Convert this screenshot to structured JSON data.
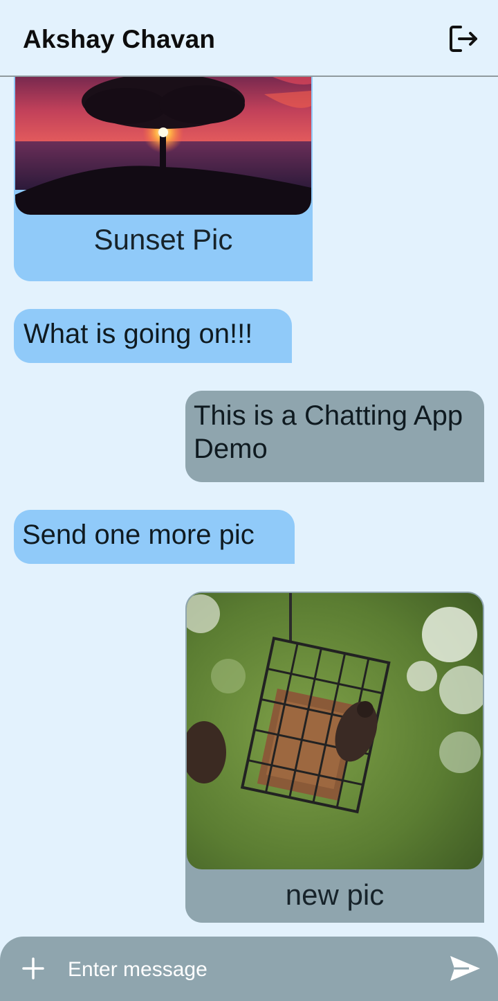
{
  "header": {
    "contact_name": "Akshay Chavan",
    "logout_icon": "logout-icon"
  },
  "messages": [
    {
      "side": "received",
      "type": "image",
      "image": "sunset-tree-photo",
      "caption": "Sunset Pic"
    },
    {
      "side": "received",
      "type": "text",
      "text": "What is going on!!!"
    },
    {
      "side": "sent",
      "type": "text",
      "text": "This is a Chatting App Demo"
    },
    {
      "side": "received",
      "type": "text",
      "text": "Send one more pic"
    },
    {
      "side": "sent",
      "type": "image",
      "image": "bird-feeder-photo",
      "caption": "new pic"
    }
  ],
  "composer": {
    "placeholder": "Enter message",
    "attach_icon": "plus-icon",
    "send_icon": "send-icon"
  },
  "colors": {
    "background": "#e3f2fd",
    "received_bubble": "#90caf9",
    "sent_bubble": "#8fa5ae",
    "composer": "#8fa5ae"
  }
}
